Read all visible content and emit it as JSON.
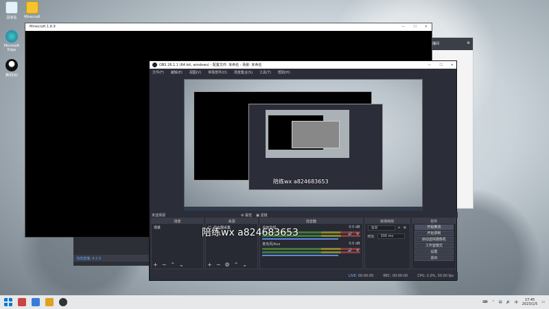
{
  "desktop": {
    "icons": [
      {
        "name": "recycle-bin-icon",
        "label": "回收站"
      },
      {
        "name": "app-icon",
        "label": "Minecraft"
      },
      {
        "name": "edge-icon",
        "label": "Microsoft Edge"
      },
      {
        "name": "qq-icon",
        "label": "腾讯QQ"
      }
    ]
  },
  "minecraft": {
    "title": "Minecraft 1.8.9"
  },
  "bg_panel": {
    "title": "管理直播间"
  },
  "bg_obs": {
    "status": "当前直播: 4 2 0"
  },
  "obs": {
    "title": "OBS 26.1.1 (64-bit, windows) - 配置文件: 未命名 - 场景: 未命名",
    "menu": [
      "文件(F)",
      "编辑(E)",
      "视图(V)",
      "停靠部件(D)",
      "场景集合(S)",
      "工具(T)",
      "帮助(H)"
    ],
    "preview_label": "未选择源",
    "panels": {
      "scenes": {
        "header": "场景",
        "items": [
          "场景"
        ]
      },
      "sources": {
        "header": "来源",
        "items": [
          "显示器采集"
        ]
      },
      "mixer": {
        "header": "混音器",
        "rows": [
          {
            "label": "桌面音频",
            "db": "0.0 dB"
          },
          {
            "label": "麦克风/Aux",
            "db": "0.0 dB"
          }
        ]
      },
      "transitions": {
        "header": "转场特效",
        "type": "淡出",
        "duration_label": "时长",
        "duration": "300 ms"
      },
      "controls": {
        "header": "控件",
        "buttons": [
          "开始推流",
          "开始录制",
          "启动虚拟摄像机",
          "工作室模式",
          "设置",
          "退出"
        ]
      }
    },
    "tabs": {
      "properties": "属性",
      "filters": "滤镜"
    },
    "status": {
      "live_label": "LIVE:",
      "live_time": "00:00:00",
      "rec_label": "REC:",
      "rec_time": "00:00:00",
      "cpu": "CPU: 2.0%, 30.00 fps"
    }
  },
  "watermark": {
    "text": "陪练wx a824683653",
    "inner": "陪练wx a824683653"
  },
  "taskbar": {
    "time": "17:45",
    "date": "2023/1/5"
  }
}
